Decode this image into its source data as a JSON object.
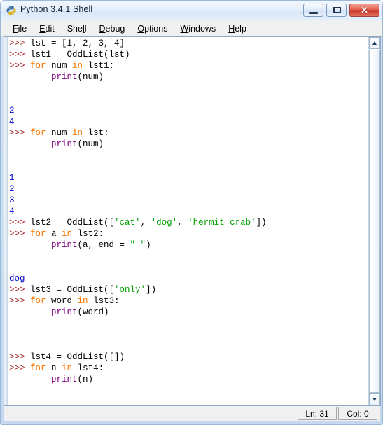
{
  "window": {
    "title": "Python 3.4.1 Shell",
    "icon": "python-logo-icon"
  },
  "titlebar_buttons": {
    "minimize_label": "",
    "maximize_label": "",
    "close_label": "✕"
  },
  "menu": {
    "items": [
      {
        "label": "File",
        "accel_index": 0
      },
      {
        "label": "Edit",
        "accel_index": 0
      },
      {
        "label": "Shell",
        "accel_index": 3
      },
      {
        "label": "Debug",
        "accel_index": 0
      },
      {
        "label": "Options",
        "accel_index": 0
      },
      {
        "label": "Windows",
        "accel_index": 0
      },
      {
        "label": "Help",
        "accel_index": 0
      }
    ]
  },
  "colors": {
    "prompt": "#a52a2a",
    "keyword": "#ff7700",
    "builtin": "#800080",
    "string": "#00a000",
    "output": "#0000cc",
    "plain": "#000000"
  },
  "shell": {
    "lines": [
      [
        {
          "t": ">>> ",
          "c": "prompt"
        },
        {
          "t": "lst = [1, 2, 3, 4]",
          "c": "plain"
        }
      ],
      [
        {
          "t": ">>> ",
          "c": "prompt"
        },
        {
          "t": "lst1 = OddList(lst)",
          "c": "plain"
        }
      ],
      [
        {
          "t": ">>> ",
          "c": "prompt"
        },
        {
          "t": "for",
          "c": "keyword"
        },
        {
          "t": " num ",
          "c": "plain"
        },
        {
          "t": "in",
          "c": "keyword"
        },
        {
          "t": " lst1:",
          "c": "plain"
        }
      ],
      [
        {
          "t": "        ",
          "c": "plain"
        },
        {
          "t": "print",
          "c": "builtin"
        },
        {
          "t": "(num)",
          "c": "plain"
        }
      ],
      [],
      [],
      [
        {
          "t": "2",
          "c": "output"
        }
      ],
      [
        {
          "t": "4",
          "c": "output"
        }
      ],
      [
        {
          "t": ">>> ",
          "c": "prompt"
        },
        {
          "t": "for",
          "c": "keyword"
        },
        {
          "t": " num ",
          "c": "plain"
        },
        {
          "t": "in",
          "c": "keyword"
        },
        {
          "t": " lst:",
          "c": "plain"
        }
      ],
      [
        {
          "t": "        ",
          "c": "plain"
        },
        {
          "t": "print",
          "c": "builtin"
        },
        {
          "t": "(num)",
          "c": "plain"
        }
      ],
      [],
      [],
      [
        {
          "t": "1",
          "c": "output"
        }
      ],
      [
        {
          "t": "2",
          "c": "output"
        }
      ],
      [
        {
          "t": "3",
          "c": "output"
        }
      ],
      [
        {
          "t": "4",
          "c": "output"
        }
      ],
      [
        {
          "t": ">>> ",
          "c": "prompt"
        },
        {
          "t": "lst2 = OddList([",
          "c": "plain"
        },
        {
          "t": "'cat'",
          "c": "string"
        },
        {
          "t": ", ",
          "c": "plain"
        },
        {
          "t": "'dog'",
          "c": "string"
        },
        {
          "t": ", ",
          "c": "plain"
        },
        {
          "t": "'hermit crab'",
          "c": "string"
        },
        {
          "t": "])",
          "c": "plain"
        }
      ],
      [
        {
          "t": ">>> ",
          "c": "prompt"
        },
        {
          "t": "for",
          "c": "keyword"
        },
        {
          "t": " a ",
          "c": "plain"
        },
        {
          "t": "in",
          "c": "keyword"
        },
        {
          "t": " lst2:",
          "c": "plain"
        }
      ],
      [
        {
          "t": "        ",
          "c": "plain"
        },
        {
          "t": "print",
          "c": "builtin"
        },
        {
          "t": "(a, end = ",
          "c": "plain"
        },
        {
          "t": "\" \"",
          "c": "string"
        },
        {
          "t": ")",
          "c": "plain"
        }
      ],
      [],
      [],
      [
        {
          "t": "dog",
          "c": "output"
        }
      ],
      [
        {
          "t": ">>> ",
          "c": "prompt"
        },
        {
          "t": "lst3 = OddList([",
          "c": "plain"
        },
        {
          "t": "'only'",
          "c": "string"
        },
        {
          "t": "])",
          "c": "plain"
        }
      ],
      [
        {
          "t": ">>> ",
          "c": "prompt"
        },
        {
          "t": "for",
          "c": "keyword"
        },
        {
          "t": " word ",
          "c": "plain"
        },
        {
          "t": "in",
          "c": "keyword"
        },
        {
          "t": " lst3:",
          "c": "plain"
        }
      ],
      [
        {
          "t": "        ",
          "c": "plain"
        },
        {
          "t": "print",
          "c": "builtin"
        },
        {
          "t": "(word)",
          "c": "plain"
        }
      ],
      [],
      [],
      [],
      [
        {
          "t": ">>> ",
          "c": "prompt"
        },
        {
          "t": "lst4 = OddList([])",
          "c": "plain"
        }
      ],
      [
        {
          "t": ">>> ",
          "c": "prompt"
        },
        {
          "t": "for",
          "c": "keyword"
        },
        {
          "t": " n ",
          "c": "plain"
        },
        {
          "t": "in",
          "c": "keyword"
        },
        {
          "t": " lst4:",
          "c": "plain"
        }
      ],
      [
        {
          "t": "        ",
          "c": "plain"
        },
        {
          "t": "print",
          "c": "builtin"
        },
        {
          "t": "(n)",
          "c": "plain"
        }
      ],
      [],
      [],
      [],
      [
        {
          "t": ">>> ",
          "c": "prompt"
        }
      ]
    ]
  },
  "statusbar": {
    "line_label": "Ln: 31",
    "col_label": "Col: 0"
  }
}
